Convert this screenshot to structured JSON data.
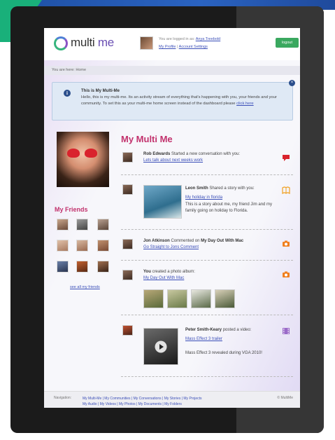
{
  "header": {
    "logo_prefix": "multi",
    "logo_suffix": "me",
    "logged_in_prefix": "You are logged in as:",
    "user_name": "Anya Treebold",
    "my_profile": "My Profile",
    "separator": "|",
    "account_settings": "Account Settings",
    "logout": "logout"
  },
  "breadcrumb": "You are here: Home",
  "info": {
    "title": "This is My Multi-Me",
    "body": "Hello, this is my multi-me. Its an activity stream of everything that's happening with you, your friends and your community. To set this as your multi-me home screen instead of the dashboard please",
    "link": "click here"
  },
  "sidebar": {
    "friends_title": "My Friends",
    "see_all": "see all my friends"
  },
  "main": {
    "title": "My Multi Me",
    "feed": [
      {
        "actor": "Rob Edwards",
        "action": "Started a new conversation with you:",
        "link": "Lets talk about next weeks work",
        "icon": "speech-bubble-icon"
      },
      {
        "actor": "Leon Smith",
        "action": "Shared a story with you:",
        "link": "My holiday in florida",
        "desc": "This is a story about me, my friend Jim and my family going on holiday to Florida.",
        "icon": "book-icon"
      },
      {
        "actor": "Jon Atkinson",
        "action": "Commented on",
        "target": "My Day Out With Mac",
        "link": "Go Straight to Jons Comment",
        "icon": "camera-icon"
      },
      {
        "actor": "You",
        "action": "created a photo album:",
        "link": "My Day Out With Mac",
        "icon": "camera-icon"
      },
      {
        "actor": "Peter Smith-Keary",
        "action": "posted a video:",
        "link": "Mass Effect 3 trailer",
        "desc": "Mass Effect 3 revealed during VGA 2010!",
        "icon": "film-icon"
      }
    ]
  },
  "footer": {
    "nav_label": "Navigation:",
    "links_line1": "My Multi-Me | My Communities | My Conversations | My Stories | My Projects",
    "links_line2": "My Audio | My Videos | My Photos | My Documents | My Folders",
    "copyright": "© MultiMe"
  },
  "colors": {
    "accent": "#c2326d",
    "link": "#3b4fb8",
    "logout": "#3aa85f"
  }
}
